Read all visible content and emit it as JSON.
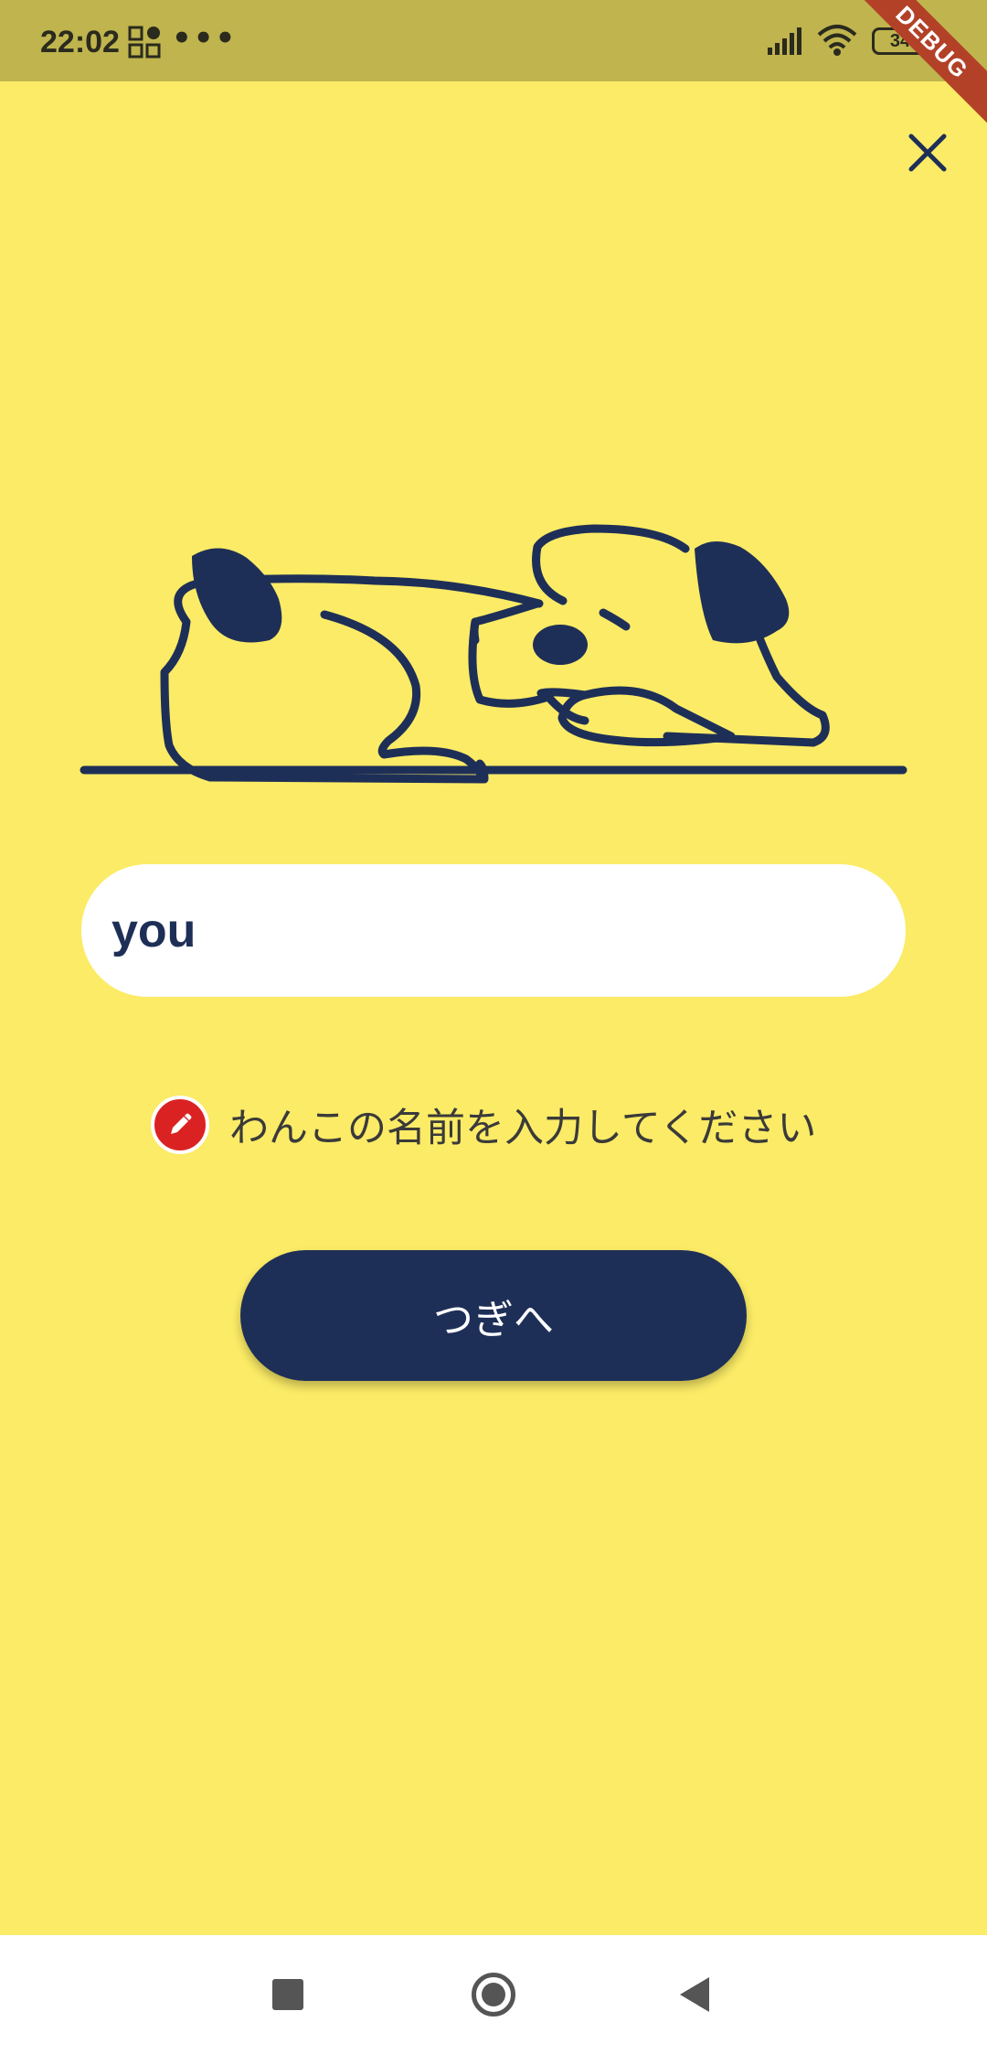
{
  "status_bar": {
    "time": "22:02",
    "more_indicator": "•••",
    "battery_level": "34",
    "icons": [
      "grid-app-icon",
      "signal-icon",
      "wifi-icon",
      "battery-icon"
    ]
  },
  "debug_banner": {
    "label": "DEBUG"
  },
  "close": {
    "icon": "close-icon"
  },
  "illustration": {
    "subject": "sleeping-dog"
  },
  "name_input": {
    "value": "you"
  },
  "hint": {
    "icon": "pencil-icon",
    "text": "わんこの名前を入力してください"
  },
  "next_button": {
    "label": "つぎへ"
  },
  "nav_bar": {
    "icons": [
      "recents-icon",
      "home-icon",
      "back-icon"
    ]
  },
  "colors": {
    "background": "#fbeb66",
    "status_bar": "#bfb44d",
    "navy": "#1e2f57",
    "badge_red": "#db2222",
    "debug_banner": "#b24128"
  }
}
